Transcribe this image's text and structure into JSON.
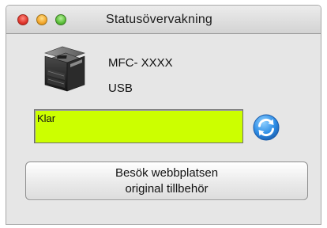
{
  "window": {
    "title": "Statusövervakning",
    "controls": [
      {
        "name": "close",
        "color": "#e0352b"
      },
      {
        "name": "minimize",
        "color": "#f2a62c"
      },
      {
        "name": "zoom",
        "color": "#5cbf3a"
      }
    ]
  },
  "device": {
    "icon": "printer-icon",
    "model": "MFC- XXXX",
    "connection": "USB"
  },
  "status": {
    "text": "Klar",
    "color": "#ccff00",
    "refresh_icon": "refresh-icon"
  },
  "link_button": {
    "line1": "Besök webbplatsen",
    "line2": "original tillbehör"
  }
}
